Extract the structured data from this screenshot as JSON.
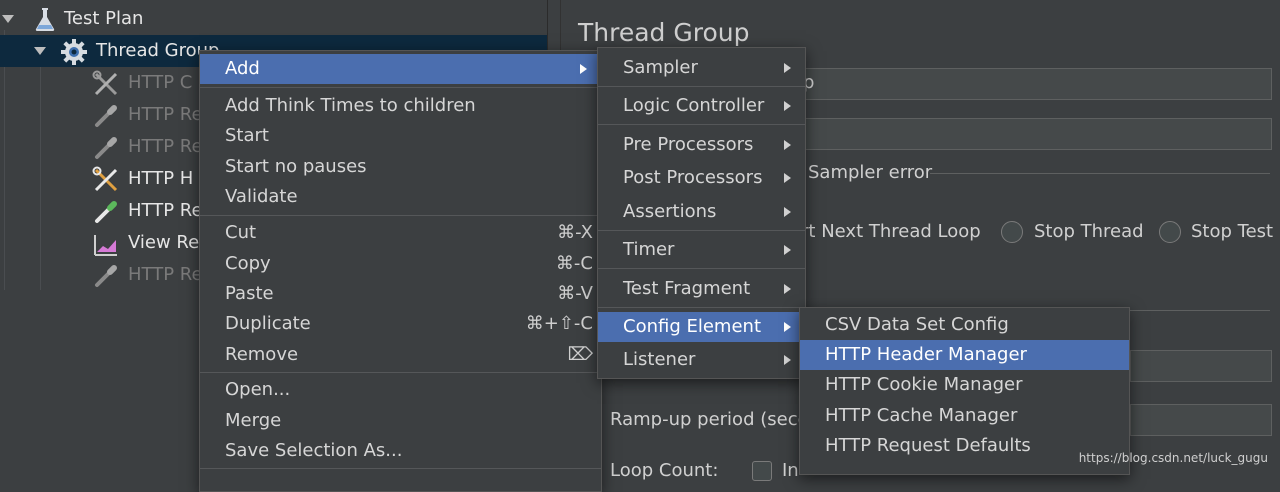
{
  "tree": {
    "items": [
      {
        "label": "Test Plan",
        "icon": "flask-icon"
      },
      {
        "label": "Thread Group",
        "icon": "gear-icon"
      },
      {
        "label": "HTTP C",
        "icon": "tools-icon"
      },
      {
        "label": "HTTP Re",
        "icon": "pipette-icon"
      },
      {
        "label": "HTTP Re",
        "icon": "pipette-icon"
      },
      {
        "label": "HTTP H",
        "icon": "tools-icon"
      },
      {
        "label": "HTTP Re",
        "icon": "pipette-icon"
      },
      {
        "label": "View Res",
        "icon": "graph-icon"
      },
      {
        "label": "HTTP Re",
        "icon": "pipette-icon"
      }
    ]
  },
  "right_panel": {
    "title": "Thread Group",
    "name_suffix": "p",
    "sampler_error": "Sampler error",
    "radios": {
      "next_loop": "art Next Thread Loop",
      "stop_thread": "Stop Thread",
      "stop_test": "Stop Test"
    },
    "ramp_up": "Ramp-up period (seco",
    "loop_count": "Loop Count:",
    "loop_count_suffix": "In"
  },
  "context_menu": {
    "add": "Add",
    "add_think_times": "Add Think Times to children",
    "start": "Start",
    "start_no_pauses": "Start no pauses",
    "validate": "Validate",
    "cut": "Cut",
    "cut_shortcut": "⌘-X",
    "copy": "Copy",
    "copy_shortcut": "⌘-C",
    "paste": "Paste",
    "paste_shortcut": "⌘-V",
    "duplicate": "Duplicate",
    "duplicate_shortcut": "⌘+⇧-C",
    "remove": "Remove",
    "remove_shortcut": "⌦",
    "open": "Open...",
    "merge": "Merge",
    "save_selection": "Save Selection As..."
  },
  "add_submenu": {
    "sampler": "Sampler",
    "logic_controller": "Logic Controller",
    "pre_processors": "Pre Processors",
    "post_processors": "Post Processors",
    "assertions": "Assertions",
    "timer": "Timer",
    "test_fragment": "Test Fragment",
    "config_element": "Config Element",
    "listener": "Listener"
  },
  "config_submenu": {
    "csv": "CSV Data Set Config",
    "header_manager": "HTTP Header Manager",
    "cookie_manager": "HTTP Cookie Manager",
    "cache_manager": "HTTP Cache Manager",
    "request_defaults": "HTTP Request Defaults"
  },
  "watermark": "https://blog.csdn.net/luck_gugu",
  "colors": {
    "background": "#3c3f41",
    "menu_highlight": "#4b6eaf",
    "tree_selection": "#0d293e"
  }
}
